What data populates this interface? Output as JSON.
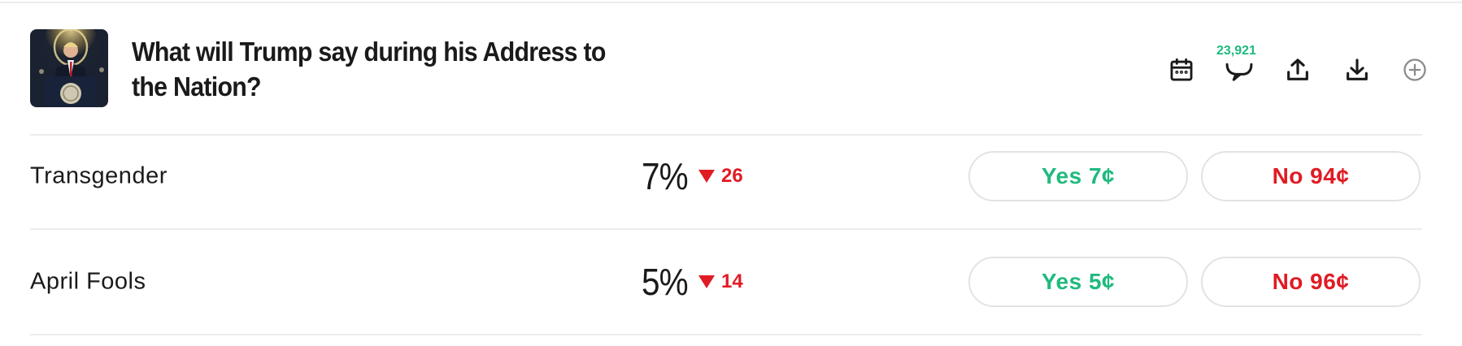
{
  "market": {
    "title": "What will Trump say during his Address to the Nation?",
    "comment_count": "23,921",
    "actions": [
      "calendar-icon",
      "comments-icon",
      "share-icon",
      "download-icon",
      "add-circle-icon"
    ]
  },
  "outcomes": [
    {
      "label": "Transgender",
      "percent": "7%",
      "change": "26",
      "change_direction": "down",
      "yes_label": "Yes 7¢",
      "no_label": "No 94¢"
    },
    {
      "label": "April Fools",
      "percent": "5%",
      "change": "14",
      "change_direction": "down",
      "yes_label": "Yes 5¢",
      "no_label": "No 96¢"
    }
  ],
  "colors": {
    "yes": "#1fba7e",
    "no": "#e01b24",
    "divider": "#ececec",
    "button_border": "#e3e3e3"
  }
}
